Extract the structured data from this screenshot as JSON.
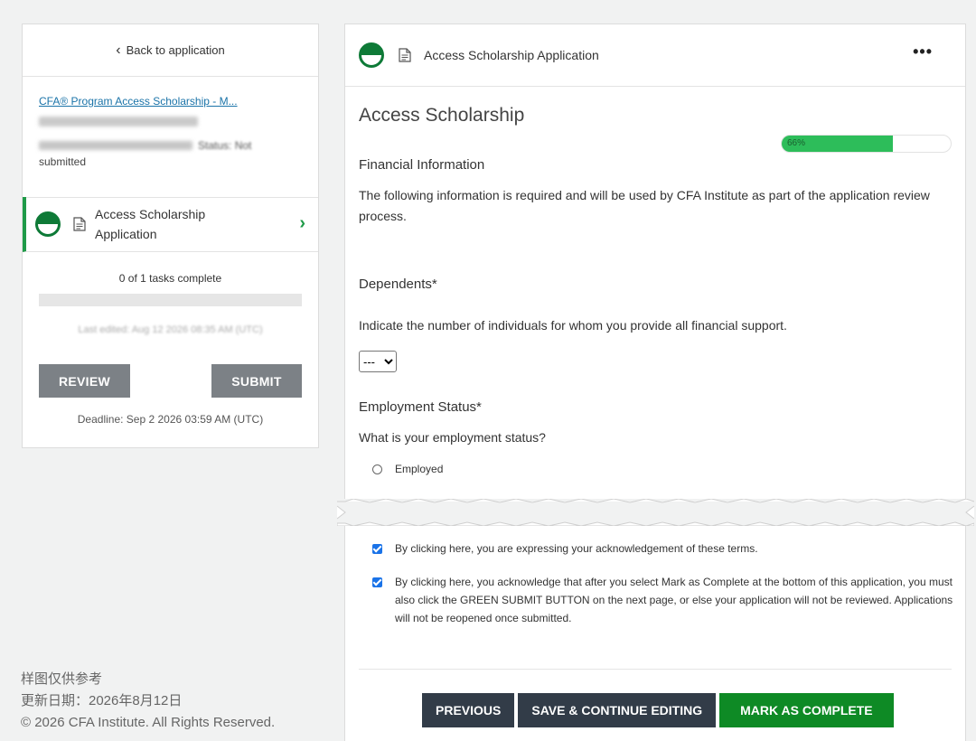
{
  "sidebar": {
    "back_label": "Back to application",
    "app_link": "CFA® Program Access Scholarship - M...",
    "status_label": "Status: Not",
    "submitted_label": "submitted",
    "task": {
      "label": "Access Scholarship Application"
    },
    "tasks_complete": "0 of 1 tasks complete",
    "last_edited": "Last edited: Aug 12 2026 08:35 AM (UTC)",
    "review_label": "REVIEW",
    "submit_label": "SUBMIT",
    "deadline": "Deadline: Sep 2 2026 03:59 AM (UTC)"
  },
  "footer": {
    "line1": "样图仅供参考",
    "line2": "更新日期：2026年8月12日",
    "line3": "© 2026 CFA Institute. All Rights Reserved."
  },
  "main": {
    "header_title": "Access Scholarship Application",
    "more_label": "•••",
    "section_title": "Access Scholarship",
    "progress": {
      "value": 66,
      "label": "66%"
    },
    "financial_title": "Financial Information",
    "financial_text": "The following information is required and will be used by CFA Institute as part of the application review process.",
    "dependents_title": "Dependents*",
    "dependents_text": "Indicate the number of individuals for whom you provide all financial support.",
    "dependents_selected": "---",
    "employment_title": "Employment Status*",
    "employment_question": "What is your employment status?",
    "employment_option": "Employed",
    "ack1": "By clicking here, you are expressing your acknowledgement of these terms.",
    "ack2": "By clicking here, you acknowledge that after you select Mark as Complete at the bottom of this application, you must also click the GREEN SUBMIT BUTTON on the next page, or else your application will not be reviewed. Applications will not be reopened once submitted.",
    "previous_label": "PREVIOUS",
    "save_label": "SAVE & CONTINUE EDITING",
    "complete_label": "MARK AS COMPLETE"
  },
  "colors": {
    "accent_green": "#1f9a48",
    "progress_green": "#2dbd5a",
    "complete_button": "#0e8a25",
    "dark_button": "#323c48",
    "gray_button": "#7c8186",
    "link": "#1a73a8"
  }
}
